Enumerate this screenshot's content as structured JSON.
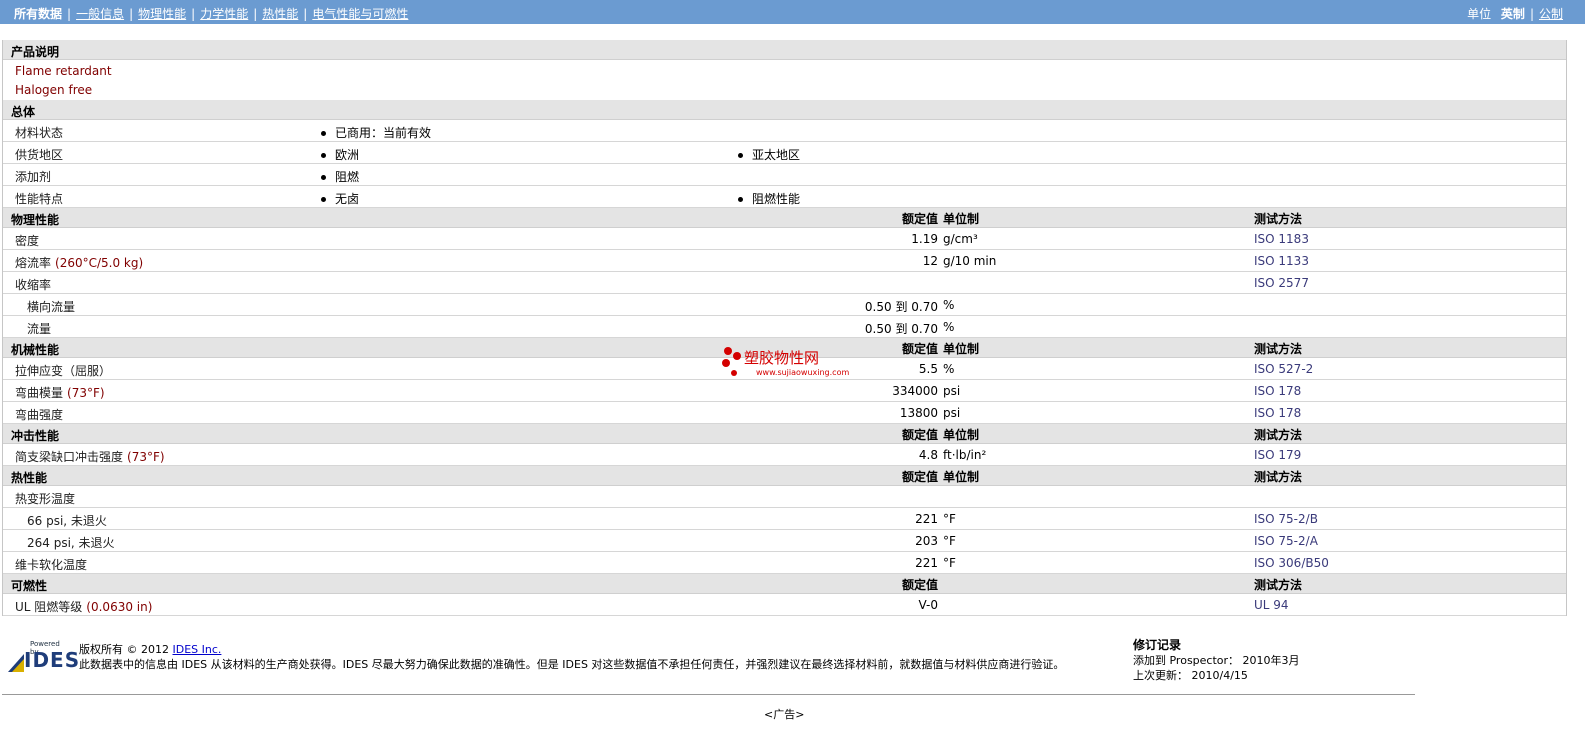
{
  "nav": {
    "all": "所有数据",
    "tabs": [
      "一般信息",
      "物理性能",
      "力学性能",
      "热性能",
      "电气性能与可燃性"
    ],
    "units_label": "单位",
    "unit_english": "英制",
    "unit_metric": "公制"
  },
  "desc": {
    "title": "产品说明",
    "lines": [
      "Flame retardant",
      "Halogen free"
    ]
  },
  "general": {
    "title": "总体",
    "rows": [
      {
        "label": "材料状态",
        "v1": "已商用：当前有效",
        "v2": ""
      },
      {
        "label": "供货地区",
        "v1": "欧洲",
        "v2": "亚太地区"
      },
      {
        "label": "添加剂",
        "v1": "阻燃",
        "v2": ""
      },
      {
        "label": "性能特点",
        "v1": "无卤",
        "v2": "阻燃性能"
      }
    ]
  },
  "headers": {
    "rated": "额定值",
    "unit": "单位制",
    "method": "测试方法"
  },
  "physical": {
    "title": "物理性能",
    "rows": [
      {
        "label": "密度",
        "cond": "",
        "value": "1.19",
        "unit": "g/cm³",
        "method": "ISO 1183",
        "indent": false
      },
      {
        "label": "熔流率",
        "cond": "(260°C/5.0 kg)",
        "value": "12",
        "unit": "g/10 min",
        "method": "ISO 1133",
        "indent": false
      },
      {
        "label": "收缩率",
        "cond": "",
        "value": "",
        "unit": "",
        "method": "ISO 2577",
        "indent": false
      },
      {
        "label": "横向流量",
        "cond": "",
        "value": "0.50 到  0.70",
        "unit": "%",
        "method": "",
        "indent": true
      },
      {
        "label": "流量",
        "cond": "",
        "value": "0.50 到  0.70",
        "unit": "%",
        "method": "",
        "indent": true
      }
    ]
  },
  "mechanical": {
    "title": "机械性能",
    "rows": [
      {
        "label": "拉伸应变（屈服）",
        "cond": "",
        "value": "5.5",
        "unit": "%",
        "method": "ISO 527-2",
        "indent": false
      },
      {
        "label": "弯曲模量",
        "cond": "(73°F)",
        "value": "334000",
        "unit": "psi",
        "method": "ISO 178",
        "indent": false
      },
      {
        "label": "弯曲强度",
        "cond": "",
        "value": "13800",
        "unit": "psi",
        "method": "ISO 178",
        "indent": false
      }
    ]
  },
  "impact": {
    "title": "冲击性能",
    "rows": [
      {
        "label": "简支梁缺口冲击强度",
        "cond": "(73°F)",
        "value": "4.8",
        "unit": "ft·lb/in²",
        "method": "ISO 179",
        "indent": false
      }
    ]
  },
  "thermal": {
    "title": "热性能",
    "rows": [
      {
        "label": "热变形温度",
        "cond": "",
        "value": "",
        "unit": "",
        "method": "",
        "indent": false
      },
      {
        "label": "66 psi, 未退火",
        "cond": "",
        "value": "221",
        "unit": "°F",
        "method": "ISO 75-2/B",
        "indent": true
      },
      {
        "label": "264 psi, 未退火",
        "cond": "",
        "value": "203",
        "unit": "°F",
        "method": "ISO 75-2/A",
        "indent": true
      },
      {
        "label": "维卡软化温度",
        "cond": "",
        "value": "221",
        "unit": "°F",
        "method": "ISO 306/B50",
        "indent": false
      }
    ]
  },
  "flammability": {
    "title": "可燃性",
    "rows": [
      {
        "label": "UL 阻燃等级",
        "cond": "(0.0630 in)",
        "value": "V-0",
        "unit": "",
        "method": "UL 94",
        "indent": false
      }
    ]
  },
  "footer": {
    "logo_small": "Powered by",
    "logo": "IDES",
    "copyright": "版权所有 © 2012",
    "company": "IDES Inc.",
    "disclaimer": "此数据表中的信息由 IDES 从该材料的生产商处获得。IDES 尽最大努力确保此数据的准确性。但是 IDES 对这些数据值不承担任何责任，并强烈建议在最终选择材料前，就数据值与材料供应商进行验证。",
    "rev_title": "修订记录",
    "added": "添加到 Prospector： 2010年3月",
    "updated": "上次更新： 2010/4/15",
    "ad": "<广告>"
  },
  "watermark": {
    "text": "塑胶物性网",
    "url": "www.sujiaowuxing.com"
  },
  "colors": {
    "topbar": "#6b9bd1",
    "section": "#e4e4e4",
    "label": "#800000",
    "watermark": "#d40000"
  }
}
